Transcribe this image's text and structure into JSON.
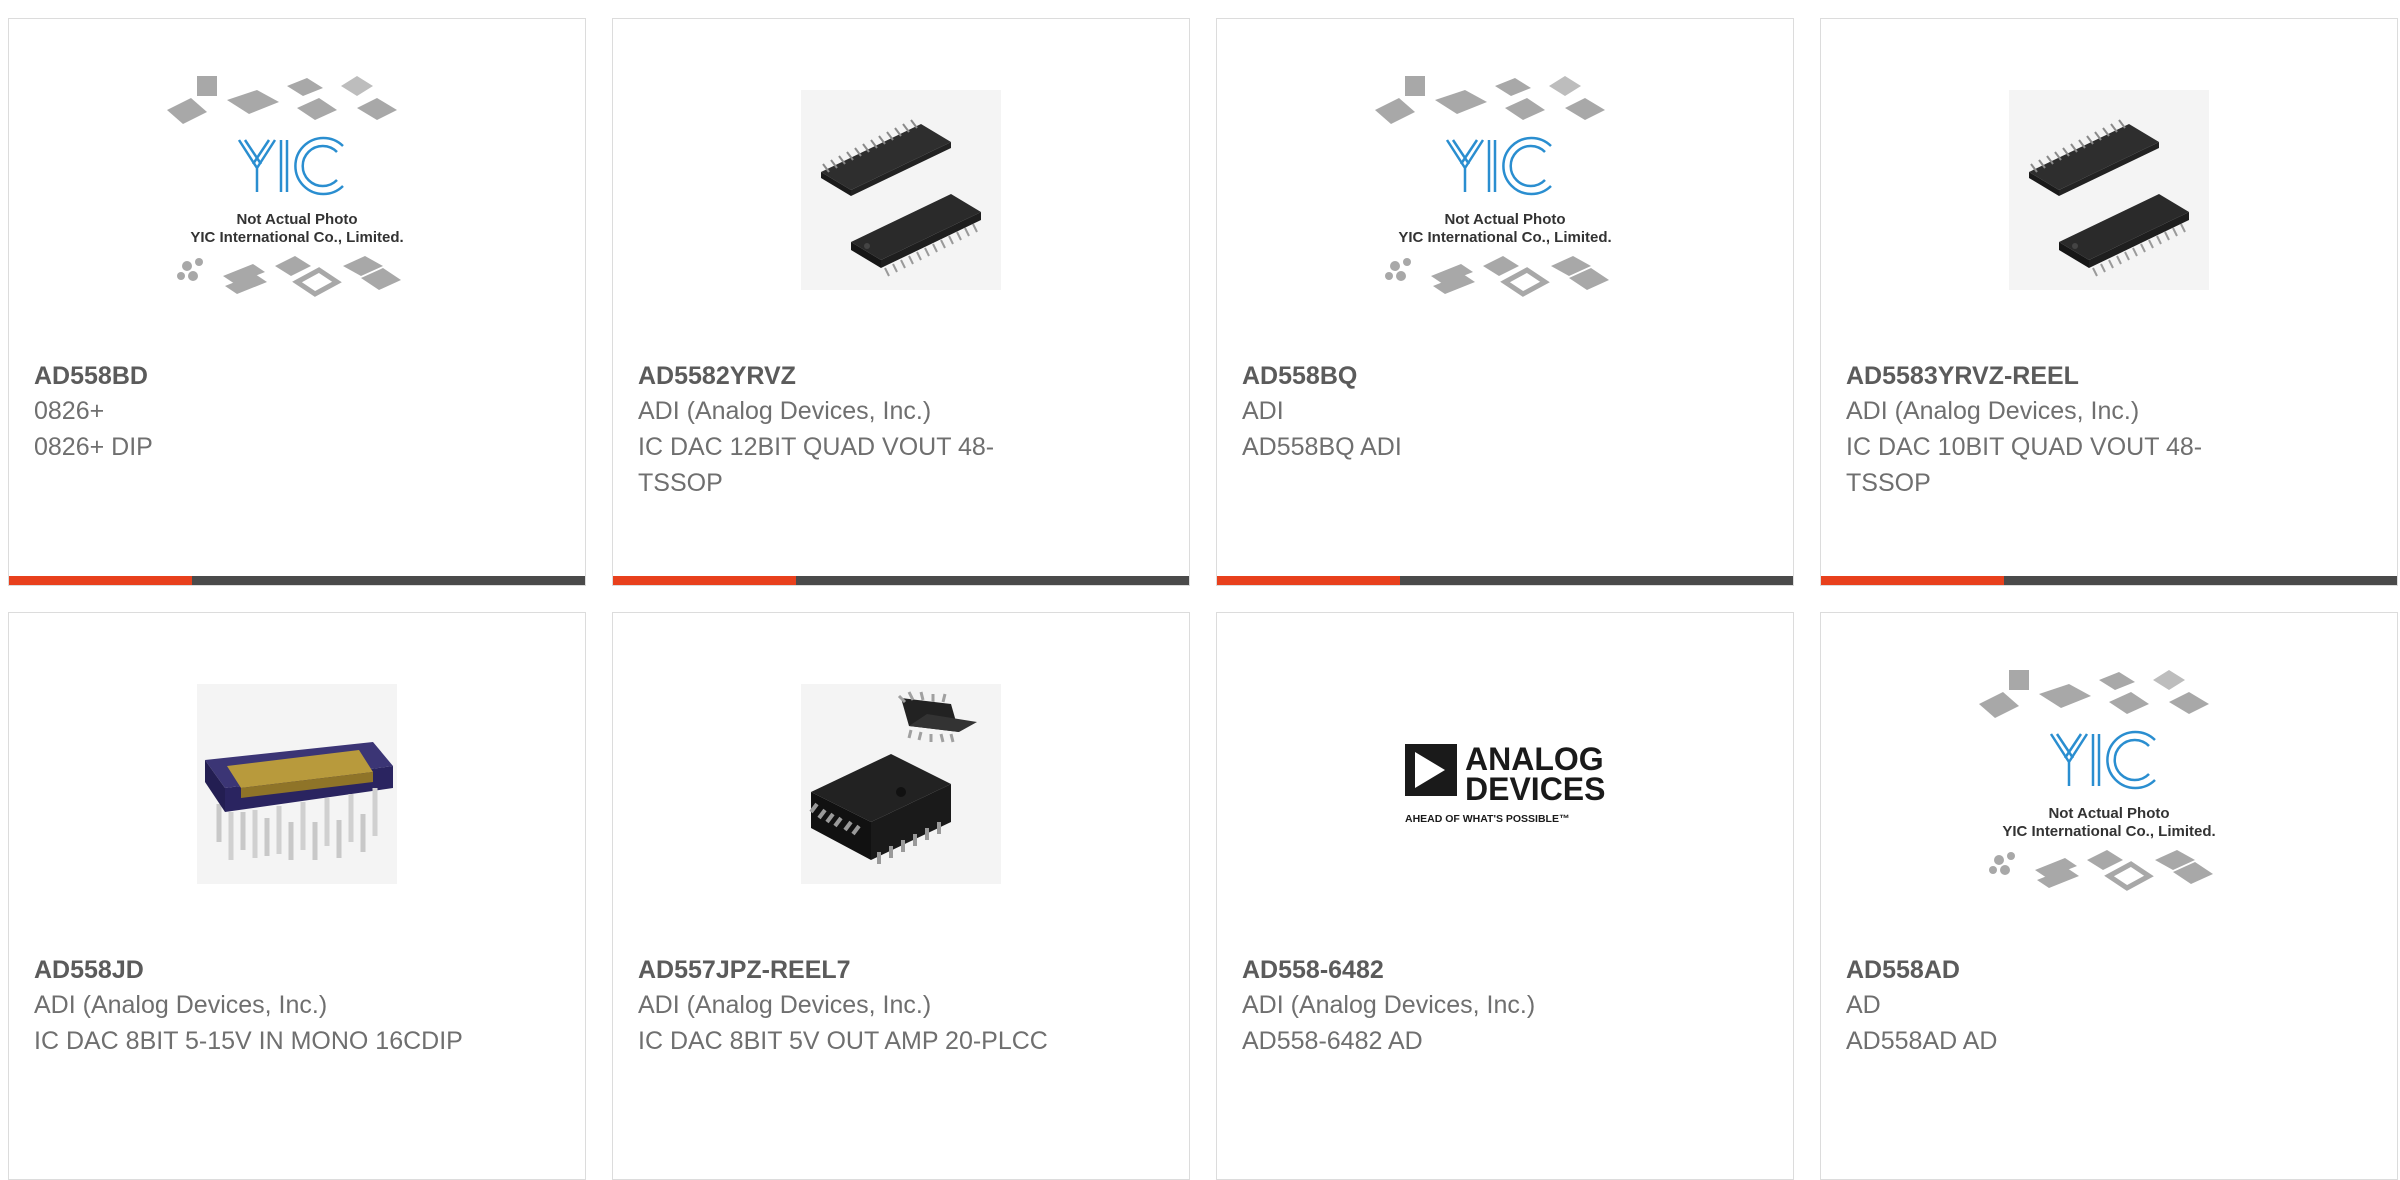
{
  "products": [
    {
      "part": "AD558BD",
      "mfr": "0826+",
      "desc": "0826+ DIP",
      "image": "yic-placeholder",
      "placeholder_line1": "Not Actual Photo",
      "placeholder_line2": "YIC International Co., Limited."
    },
    {
      "part": "AD5582YRVZ",
      "mfr": "ADI (Analog Devices, Inc.)",
      "desc": "IC DAC 12BIT QUAD VOUT 48-TSSOP",
      "image": "tssop-chip"
    },
    {
      "part": "AD558BQ",
      "mfr": "ADI",
      "desc": "AD558BQ ADI",
      "image": "yic-placeholder",
      "placeholder_line1": "Not Actual Photo",
      "placeholder_line2": "YIC International Co., Limited."
    },
    {
      "part": "AD5583YRVZ-REEL",
      "mfr": "ADI (Analog Devices, Inc.)",
      "desc": "IC DAC 10BIT QUAD VOUT 48-TSSOP",
      "image": "tssop-chip"
    },
    {
      "part": "AD558JD",
      "mfr": "ADI (Analog Devices, Inc.)",
      "desc": "IC DAC 8BIT 5-15V IN MONO 16CDIP",
      "image": "cdip-chip"
    },
    {
      "part": "AD557JPZ-REEL7",
      "mfr": "ADI (Analog Devices, Inc.)",
      "desc": "IC DAC 8BIT 5V OUT AMP 20-PLCC",
      "image": "plcc-chip"
    },
    {
      "part": "AD558-6482",
      "mfr": "ADI (Analog Devices, Inc.)",
      "desc": "AD558-6482 AD",
      "image": "analog-devices-logo",
      "logo_line1": "ANALOG",
      "logo_line2": "DEVICES",
      "logo_tagline": "AHEAD OF WHAT'S POSSIBLE™"
    },
    {
      "part": "AD558AD",
      "mfr": "AD",
      "desc": "AD558AD AD",
      "image": "yic-placeholder",
      "placeholder_line1": "Not Actual Photo",
      "placeholder_line2": "YIC International Co., Limited."
    }
  ],
  "colors": {
    "accent": "#e8401c",
    "bar_dark": "#4a4a4a",
    "card_border": "#dcdcdc",
    "text_part": "#5b5b5b",
    "text_body": "#6f6f6f",
    "yic_blue": "#2a8ed0"
  }
}
